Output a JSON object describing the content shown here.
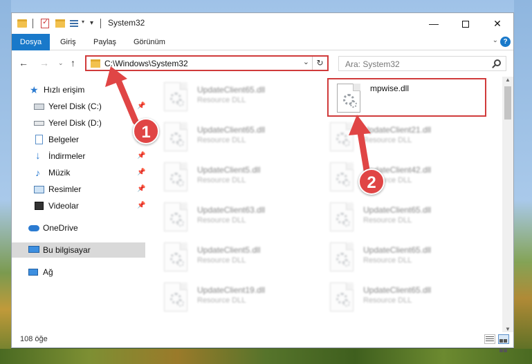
{
  "window": {
    "title": "System32"
  },
  "ribbon": {
    "tabs": [
      "Dosya",
      "Giriş",
      "Paylaş",
      "Görünüm"
    ],
    "help": "?"
  },
  "address": {
    "path": "C:\\Windows\\System32",
    "search_placeholder": "Ara: System32"
  },
  "sidebar": {
    "items": [
      {
        "label": "Hızlı erişim",
        "icon": "star-icon",
        "pinned": false
      },
      {
        "label": "Yerel Disk (C:)",
        "icon": "drive-icon",
        "pinned": true
      },
      {
        "label": "Yerel Disk (D:)",
        "icon": "drive-icon",
        "pinned": false
      },
      {
        "label": "Belgeler",
        "icon": "documents-icon",
        "pinned": true
      },
      {
        "label": "İndirmeler",
        "icon": "download-icon",
        "pinned": true
      },
      {
        "label": "Müzik",
        "icon": "music-icon",
        "pinned": true
      },
      {
        "label": "Resimler",
        "icon": "pictures-icon",
        "pinned": true
      },
      {
        "label": "Videolar",
        "icon": "video-icon",
        "pinned": true
      },
      {
        "label": "OneDrive",
        "icon": "cloud-icon",
        "pinned": false
      },
      {
        "label": "Bu bilgisayar",
        "icon": "computer-icon",
        "pinned": false,
        "selected": true
      },
      {
        "label": "Ağ",
        "icon": "network-icon",
        "pinned": false
      }
    ]
  },
  "files": [
    {
      "name": "UpdateClient65.dll",
      "type": "Resource DLL"
    },
    {
      "name": "mpwise.dll",
      "type": ""
    },
    {
      "name": "UpdateClient65.dll",
      "type": "Resource DLL"
    },
    {
      "name": "UpdateClient21.dll",
      "type": "Resource DLL"
    },
    {
      "name": "UpdateClient5.dll",
      "type": "Resource DLL"
    },
    {
      "name": "UpdateClient42.dll",
      "type": "Resource DLL"
    },
    {
      "name": "UpdateClient63.dll",
      "type": "Resource DLL"
    },
    {
      "name": "UpdateClient65.dll",
      "type": "Resource DLL"
    },
    {
      "name": "UpdateClient5.dll",
      "type": "Resource DLL"
    },
    {
      "name": "UpdateClient65.dll",
      "type": "Resource DLL"
    },
    {
      "name": "UpdateClient19.dll",
      "type": "Resource DLL"
    },
    {
      "name": "UpdateClient65.dll",
      "type": "Resource DLL"
    }
  ],
  "status": {
    "item_count": "108 öğe"
  },
  "annotations": {
    "badge1": "1",
    "badge2": "2",
    "color": "#e04545"
  }
}
